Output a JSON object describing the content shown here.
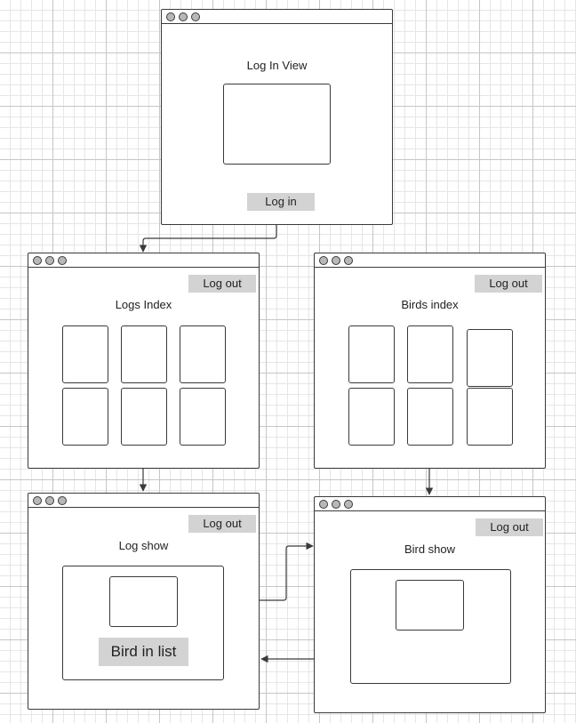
{
  "windows": {
    "login": {
      "title": "Log In View",
      "button_label": "Log in"
    },
    "logs_index": {
      "title": "Logs Index",
      "logout_label": "Log out"
    },
    "birds_index": {
      "title": "Birds index",
      "logout_label": "Log out"
    },
    "log_show": {
      "title": "Log show",
      "logout_label": "Log out",
      "list_label": "Bird in list"
    },
    "bird_show": {
      "title": "Bird show",
      "logout_label": "Log out"
    }
  },
  "colors": {
    "stroke": "#3a3a3a",
    "button_fill": "#d3d3d3",
    "grid": "#c6c6c6"
  }
}
